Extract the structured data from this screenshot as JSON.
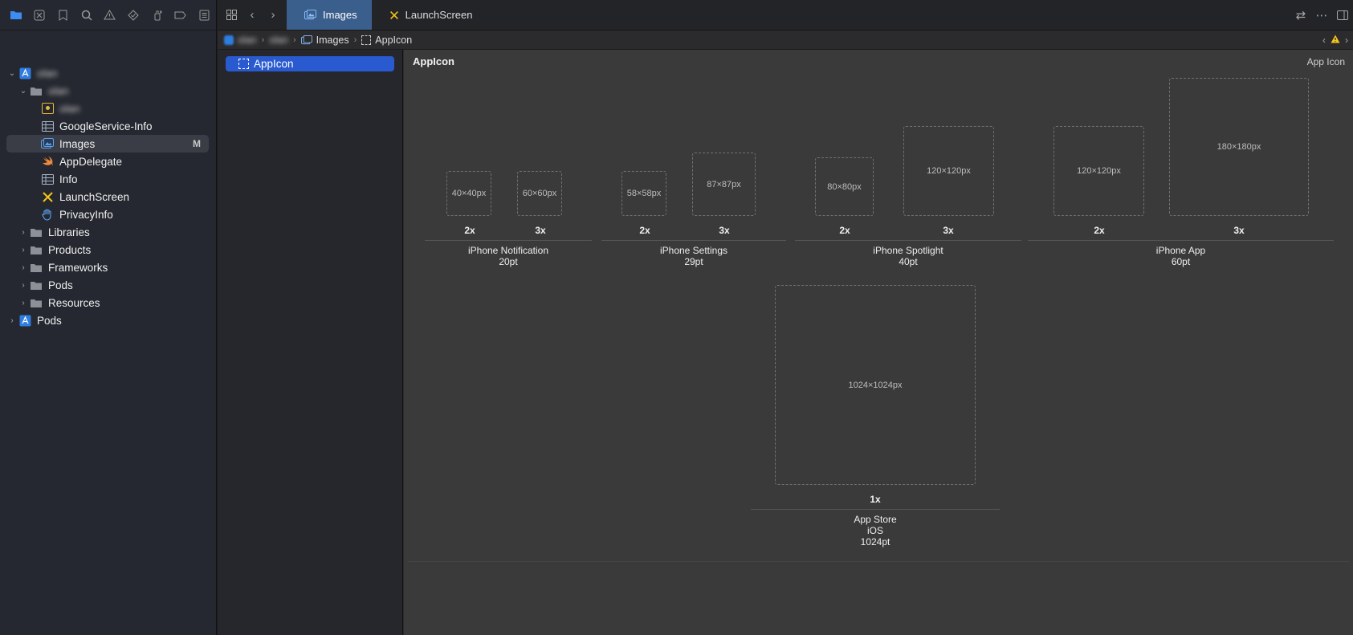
{
  "navigator": {
    "items": [
      {
        "label": "olan",
        "blurred": true
      },
      {
        "label": "olan",
        "blurred": true
      },
      {
        "label": "olan",
        "blurred": true
      },
      {
        "label": "GoogleService-Info"
      },
      {
        "label": "Images",
        "badge": "M"
      },
      {
        "label": "AppDelegate"
      },
      {
        "label": "Info"
      },
      {
        "label": "LaunchScreen"
      },
      {
        "label": "PrivacyInfo"
      },
      {
        "label": "Libraries"
      },
      {
        "label": "Products"
      },
      {
        "label": "Frameworks"
      },
      {
        "label": "Pods"
      },
      {
        "label": "Resources"
      },
      {
        "label": "Pods"
      }
    ]
  },
  "tabs": [
    {
      "label": "Images"
    },
    {
      "label": "LaunchScreen"
    }
  ],
  "jumpbar": {
    "blur1": "olan",
    "blur2": "olan",
    "images": "Images",
    "appicon": "AppIcon"
  },
  "asset_list": {
    "selected": "AppIcon"
  },
  "canvas": {
    "title": "AppIcon",
    "type": "App Icon",
    "groups": [
      {
        "name": "iPhone Notification",
        "size": "20pt",
        "slots": [
          {
            "px": "40×40px",
            "scale": "2x"
          },
          {
            "px": "60×60px",
            "scale": "3x"
          }
        ]
      },
      {
        "name": "iPhone Settings",
        "size": "29pt",
        "slots": [
          {
            "px": "58×58px",
            "scale": "2x"
          },
          {
            "px": "87×87px",
            "scale": "3x"
          }
        ]
      },
      {
        "name": "iPhone Spotlight",
        "size": "40pt",
        "slots": [
          {
            "px": "80×80px",
            "scale": "2x"
          },
          {
            "px": "120×120px",
            "scale": "3x"
          }
        ]
      },
      {
        "name": "iPhone App",
        "size": "60pt",
        "slots": [
          {
            "px": "120×120px",
            "scale": "2x"
          },
          {
            "px": "180×180px",
            "scale": "3x"
          }
        ]
      },
      {
        "name": "App Store",
        "platform": "iOS",
        "size": "1024pt",
        "slots": [
          {
            "px": "1024×1024px",
            "scale": "1x"
          }
        ]
      }
    ]
  },
  "colors": {
    "accent": "#2a5ad0",
    "active_tab": "#3b5f8c",
    "swift": "#f08a3a",
    "warning": "#f5c518"
  }
}
